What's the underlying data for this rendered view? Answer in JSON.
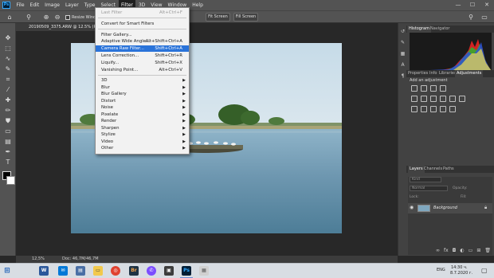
{
  "menubar": {
    "items": [
      "File",
      "Edit",
      "Image",
      "Layer",
      "Type",
      "Select",
      "Filter",
      "3D",
      "View",
      "Window",
      "Help"
    ],
    "active": "Filter"
  },
  "window_controls": {
    "minimize": "—",
    "maximize": "☐",
    "close": "✕"
  },
  "options_bar": {
    "resize_windows_label": "Resize Window",
    "fit_screen_1": "Fit Screen",
    "fit_screen_2": "Fit Screen",
    "fill_screen": "Fill Screen"
  },
  "document": {
    "tab_title": "20190509_3375.ARW @ 12.5% (R",
    "zoom": "12,5%",
    "doc_size": "Doc: 46,7M/46,7M"
  },
  "filter_menu": {
    "last_filter": {
      "label": "Last Filter",
      "shortcut": "Alt+Ctrl+F"
    },
    "convert": {
      "label": "Convert for Smart Filters"
    },
    "filter_gallery": {
      "label": "Filter Gallery..."
    },
    "adaptive_wide": {
      "label": "Adaptive Wide Angle...",
      "shortcut": "Alt+Shift+Ctrl+A"
    },
    "camera_raw": {
      "label": "Camera Raw Filter...",
      "shortcut": "Shift+Ctrl+A"
    },
    "lens_correction": {
      "label": "Lens Correction...",
      "shortcut": "Shift+Ctrl+R"
    },
    "liquify": {
      "label": "Liquify...",
      "shortcut": "Shift+Ctrl+X"
    },
    "vanishing_point": {
      "label": "Vanishing Point...",
      "shortcut": "Alt+Ctrl+V"
    },
    "submenus": [
      "3D",
      "Blur",
      "Blur Gallery",
      "Distort",
      "Noise",
      "Pixelate",
      "Render",
      "Sharpen",
      "Stylize",
      "Video",
      "Other"
    ]
  },
  "panels": {
    "histogram_tabs": [
      "Histogram",
      "Navigator"
    ],
    "properties_tabs": [
      "Properties",
      "Info",
      "Libraries",
      "Adjustments"
    ],
    "add_adjustment": "Add an adjustment",
    "layers_tabs": [
      "Layers",
      "Channels",
      "Paths"
    ],
    "kind_placeholder": "Kind",
    "blend_mode": "Normal",
    "opacity_label": "Opacity:",
    "lock_label": "Lock:",
    "fill_label": "Fill:",
    "layer_name": "Background"
  },
  "taskbar": {
    "time": "14:30 ч.",
    "date": "8.7.2020 г.",
    "language": "ENG"
  },
  "colors": {
    "ui_dark": "#282828",
    "ui_panel": "#424242",
    "menu_highlight": "#2a73d9",
    "sky": "#b9d2e3",
    "water": "#5e8aa3"
  }
}
